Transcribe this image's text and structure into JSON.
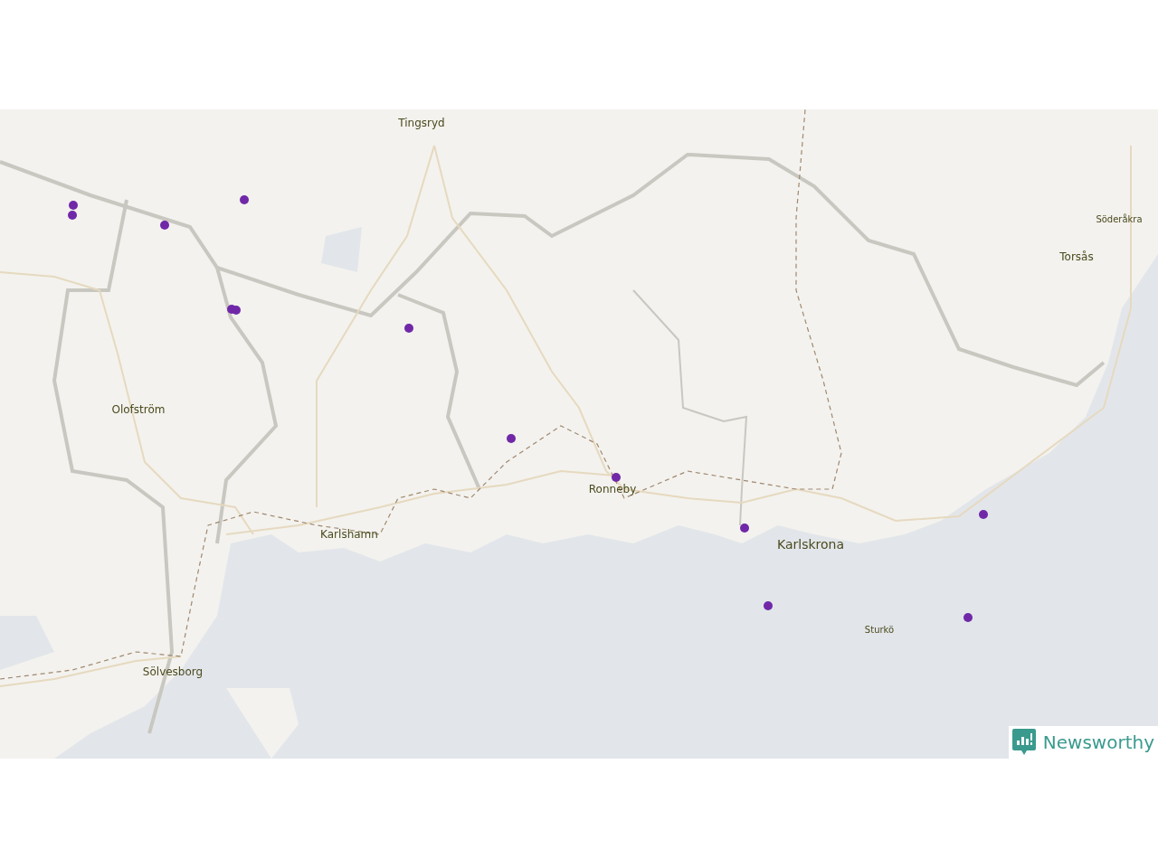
{
  "map": {
    "places": [
      {
        "name": "Tingsryd",
        "kind": "town"
      },
      {
        "name": "Olofström",
        "kind": "town"
      },
      {
        "name": "Karlshamn",
        "kind": "town"
      },
      {
        "name": "Ronneby",
        "kind": "town"
      },
      {
        "name": "Karlskrona",
        "kind": "city"
      },
      {
        "name": "Sölvesborg",
        "kind": "town"
      },
      {
        "name": "Sturkö",
        "kind": "village"
      },
      {
        "name": "Söderåkra",
        "kind": "village"
      },
      {
        "name": "Torsås",
        "kind": "town"
      }
    ]
  },
  "logo": {
    "text": "Newsworthy"
  }
}
